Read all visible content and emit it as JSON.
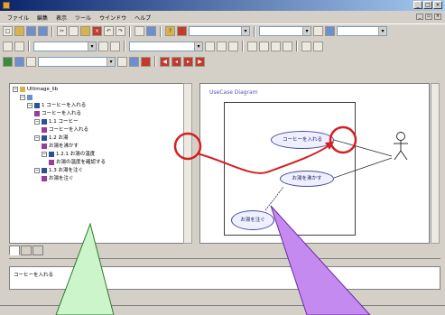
{
  "window": {
    "title": "",
    "buttons": [
      "_",
      "□",
      "×"
    ]
  },
  "menu": {
    "items": [
      "ファイル",
      "編集",
      "表示",
      "ツール",
      "ウインドウ",
      "ヘルプ"
    ]
  },
  "toolbar": {
    "combo1": "",
    "combo2": "",
    "combo3": "",
    "combo4": "",
    "combo5": ""
  },
  "tree": {
    "rows": [
      {
        "indent": 0,
        "text": "Ultimage_lib",
        "kind": "folder",
        "twisty": "−"
      },
      {
        "indent": 1,
        "text": "",
        "kind": "pkg",
        "twisty": "−"
      },
      {
        "indent": 2,
        "text": "1 コーヒーを入れる",
        "kind": "item",
        "twisty": "−"
      },
      {
        "indent": 3,
        "text": "コーヒーを入れる",
        "kind": "note",
        "twisty": ""
      },
      {
        "indent": 3,
        "text": "1.1 コーヒー",
        "kind": "item",
        "twisty": "−"
      },
      {
        "indent": 4,
        "text": "コーヒーを入れる",
        "kind": "note",
        "twisty": ""
      },
      {
        "indent": 3,
        "text": "1.2 お湯",
        "kind": "item",
        "twisty": "−"
      },
      {
        "indent": 4,
        "text": "お湯を沸かす",
        "kind": "note",
        "twisty": ""
      },
      {
        "indent": 4,
        "text": "1.2.1 お湯の温度",
        "kind": "item",
        "twisty": "−"
      },
      {
        "indent": 5,
        "text": "お湯の温度を確認する",
        "kind": "note",
        "twisty": ""
      },
      {
        "indent": 3,
        "text": "1.3 お湯を注ぐ",
        "kind": "item",
        "twisty": "−"
      },
      {
        "indent": 4,
        "text": "お湯を注ぐ",
        "kind": "note",
        "twisty": ""
      }
    ]
  },
  "left_tabs": [
    "",
    "",
    ""
  ],
  "diagram": {
    "title": "UseCase Diagram",
    "tag": "",
    "usecases": [
      "コーヒーを入れる",
      "お湯を沸かす",
      "お湯を注ぐ"
    ]
  },
  "output": {
    "line1": "コーヒーを入れる",
    "line2": ""
  },
  "status": {
    "row": [
      "",
      "",
      ""
    ],
    "bar": ""
  },
  "colors": {
    "annotation_red": "#d42020",
    "callout_green": "#ccf5cc",
    "callout_purple": "#c58af0"
  }
}
